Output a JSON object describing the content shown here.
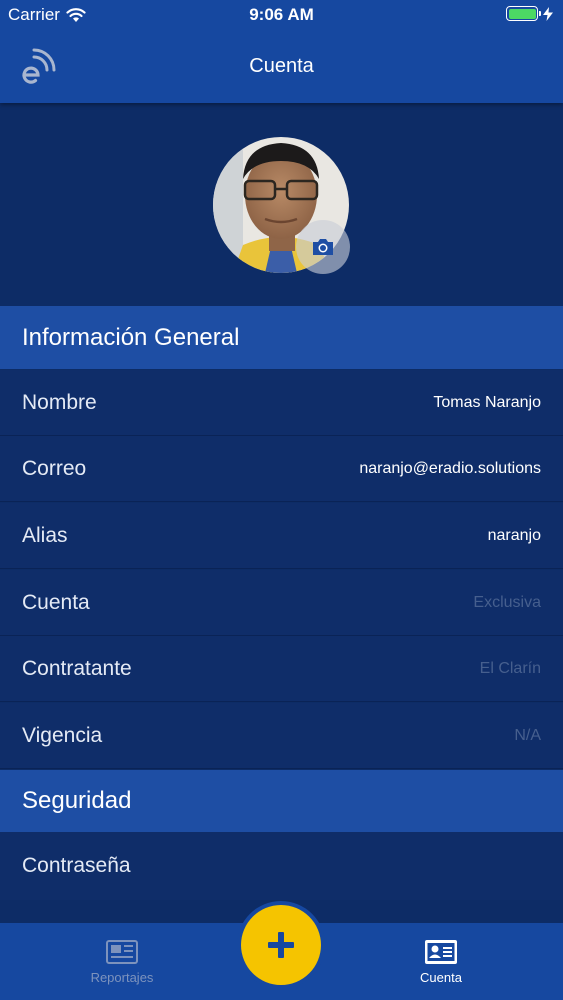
{
  "status_bar": {
    "carrier": "Carrier",
    "time": "9:06 AM",
    "battery_level": 1.0,
    "battery_color": "#4cd964"
  },
  "nav": {
    "title": "Cuenta",
    "logo_icon": "eradio-logo-icon"
  },
  "profile": {
    "avatar_icon": "user-avatar",
    "camera_icon": "camera-icon"
  },
  "sections": {
    "general": {
      "title": "Información General",
      "rows": [
        {
          "label": "Nombre",
          "value": "Tomas Naranjo",
          "enabled": true
        },
        {
          "label": "Correo",
          "value": "naranjo@eradio.solutions",
          "enabled": true
        },
        {
          "label": "Alias",
          "value": "naranjo",
          "enabled": true
        },
        {
          "label": "Cuenta",
          "value": "Exclusiva",
          "enabled": false
        },
        {
          "label": "Contratante",
          "value": "El Clarín",
          "enabled": false
        },
        {
          "label": "Vigencia",
          "value": "N/A",
          "enabled": false
        }
      ]
    },
    "security": {
      "title": "Seguridad",
      "rows": [
        {
          "label": "Contraseña"
        }
      ]
    }
  },
  "tab_bar": {
    "tabs": [
      {
        "label": "Reportajes",
        "icon": "newspaper-icon",
        "active": false
      },
      {
        "label": "Cuenta",
        "icon": "id-card-icon",
        "active": true
      }
    ],
    "fab_icon": "plus-icon",
    "fab_color": "#f5c400"
  },
  "colors": {
    "primary": "#1648a0",
    "background": "#0d2c66",
    "section_header": "#1e4ea4",
    "accent": "#f5c400"
  }
}
